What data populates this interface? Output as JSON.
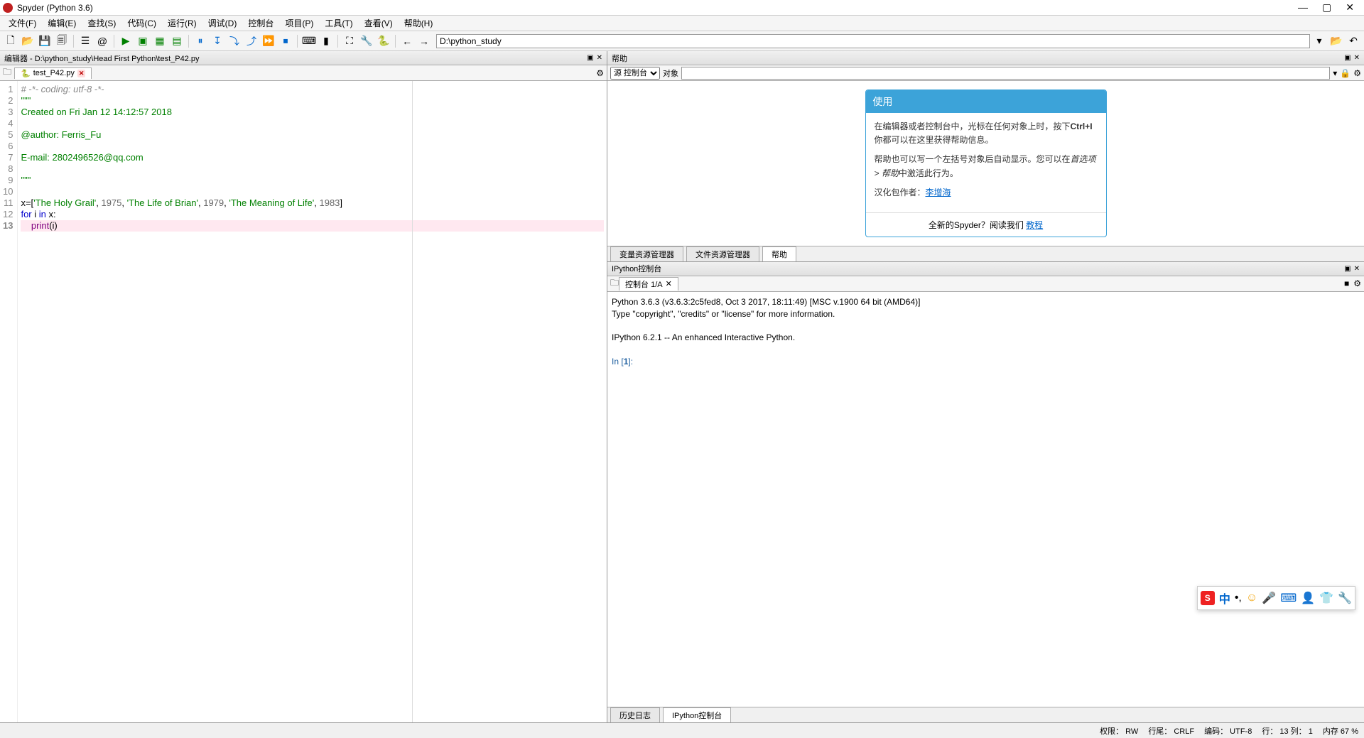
{
  "window": {
    "title": "Spyder (Python 3.6)"
  },
  "menu": {
    "file": "文件(F)",
    "edit": "编辑(E)",
    "search": "查找(S)",
    "code": "代码(C)",
    "run": "运行(R)",
    "debug": "调试(D)",
    "console": "控制台",
    "project": "项目(P)",
    "tools": "工具(T)",
    "view": "查看(V)",
    "help": "帮助(H)"
  },
  "toolbar": {
    "working_dir": "D:\\python_study"
  },
  "editor": {
    "header": "编辑器 - D:\\python_study\\Head First Python\\test_P42.py",
    "tab_name": "test_P42.py",
    "lines": [
      {
        "num": "1",
        "type": "comment",
        "text": "# -*- coding: utf-8 -*-"
      },
      {
        "num": "2",
        "type": "docstring",
        "text": "\"\"\""
      },
      {
        "num": "3",
        "type": "docstring",
        "text": "Created on Fri Jan 12 14:12:57 2018"
      },
      {
        "num": "4",
        "type": "docstring",
        "text": ""
      },
      {
        "num": "5",
        "type": "docstring",
        "text": "@author: Ferris_Fu"
      },
      {
        "num": "6",
        "type": "docstring",
        "text": ""
      },
      {
        "num": "7",
        "type": "docstring",
        "text": "E-mail: 2802496526@qq.com"
      },
      {
        "num": "8",
        "type": "docstring",
        "text": ""
      },
      {
        "num": "9",
        "type": "docstring",
        "text": "\"\"\""
      },
      {
        "num": "10",
        "type": "blank",
        "text": ""
      },
      {
        "num": "11",
        "type": "code",
        "segments": [
          {
            "c": "plain",
            "t": "x=["
          },
          {
            "c": "str",
            "t": "'The Holy Grail'"
          },
          {
            "c": "plain",
            "t": ", "
          },
          {
            "c": "num",
            "t": "1975"
          },
          {
            "c": "plain",
            "t": ", "
          },
          {
            "c": "str",
            "t": "'The Life of Brian'"
          },
          {
            "c": "plain",
            "t": ", "
          },
          {
            "c": "num",
            "t": "1979"
          },
          {
            "c": "plain",
            "t": ", "
          },
          {
            "c": "str",
            "t": "'The Meaning of Life'"
          },
          {
            "c": "plain",
            "t": ", "
          },
          {
            "c": "num",
            "t": "1983"
          },
          {
            "c": "plain",
            "t": "]"
          }
        ]
      },
      {
        "num": "12",
        "type": "code",
        "segments": [
          {
            "c": "kw",
            "t": "for"
          },
          {
            "c": "plain",
            "t": " i "
          },
          {
            "c": "kw",
            "t": "in"
          },
          {
            "c": "plain",
            "t": " x:"
          }
        ]
      },
      {
        "num": "13",
        "type": "current",
        "segments": [
          {
            "c": "plain",
            "t": "    "
          },
          {
            "c": "builtin",
            "t": "print"
          },
          {
            "c": "plain",
            "t": "(i)"
          }
        ]
      }
    ]
  },
  "help": {
    "header": "帮助",
    "source_label": "源 控制台",
    "object_label": "对象",
    "card_title": "使用",
    "para1_a": "在编辑器或者控制台中，光标在任何对象上时，按下",
    "para1_kbd": "Ctrl+I",
    "para1_b": "你都可以在这里获得帮助信息。",
    "para2_a": "帮助也可以写一个左括号对象后自动显示。您可以在",
    "para2_pref": "首选项 > 帮助",
    "para2_b": "中激活此行为。",
    "credit_label": "汉化包作者：",
    "credit_name": "李增海",
    "footer_a": "全新的Spyder？阅读我们 ",
    "footer_link": "教程",
    "tabs": {
      "var_explorer": "变量资源管理器",
      "file_explorer": "文件资源管理器",
      "help": "帮助"
    }
  },
  "console": {
    "header": "IPython控制台",
    "tab_name": "控制台 1/A",
    "line1": "Python 3.6.3 (v3.6.3:2c5fed8, Oct  3 2017, 18:11:49) [MSC v.1900 64 bit (AMD64)]",
    "line2": "Type \"copyright\", \"credits\" or \"license\" for more information.",
    "line3": "IPython 6.2.1 -- An enhanced Interactive Python.",
    "prompt_in": "In [",
    "prompt_num": "1",
    "prompt_close": "]:",
    "tabs": {
      "history": "历史日志",
      "ipython": "IPython控制台"
    }
  },
  "status": {
    "perm": "权限：  RW",
    "eol": "行尾：  CRLF",
    "encoding": "编码：  UTF-8",
    "pos": "行：  13  列：  1",
    "mem": "内存  67 %"
  },
  "ime": {
    "s": "S",
    "lang": "中"
  }
}
